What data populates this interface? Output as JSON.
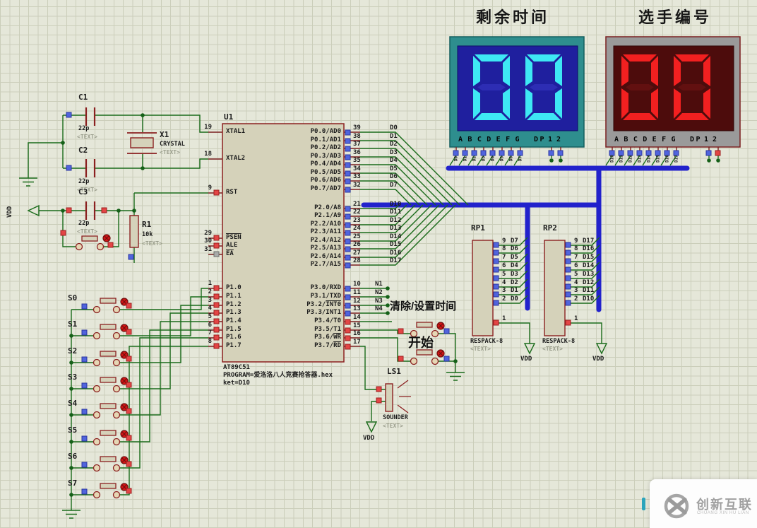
{
  "colors": {
    "bus": "#2222cc",
    "wire": "#1a6b1a",
    "outline": "#8b2020",
    "component_fill": "#d5d2ba",
    "grid_bg": "#e5e7d9",
    "grid_line": "#cbceba",
    "time_frame": "#2e8e8e",
    "time_bg": "#1f1f9e",
    "time_lit": "#3ee8f4",
    "time_dim": "#2d2db4",
    "player_frame": "#9a9a9a",
    "player_bg": "#4d0c0c",
    "player_lit": "#f22020",
    "player_dim": "#621010",
    "state_low": "#5064dd",
    "state_high": "#e34545",
    "state_float": "#a8aaa8"
  },
  "titles": {
    "time": "剩余时间",
    "player": "选手编号"
  },
  "displays": {
    "legend": "ABCDEFG",
    "dp": "DP",
    "commons": "12",
    "time_value": "00",
    "player_value": "00"
  },
  "u1": {
    "ref": "U1",
    "part": "AT89C51",
    "program": "PROGRAM=爱洛洛八人竞赛抢答器.hex",
    "note": "ket=D10",
    "left": [
      {
        "num": "19",
        "name": "XTAL1"
      },
      {
        "num": "18",
        "name": "XTAL2"
      },
      {
        "num": "9",
        "name": "RST"
      },
      {
        "num": "29",
        "ovname": "PSEN"
      },
      {
        "num": "30",
        "name": "ALE"
      },
      {
        "num": "31",
        "ovname": "EA"
      },
      {
        "num": "1",
        "name": "P1.0"
      },
      {
        "num": "2",
        "name": "P1.1"
      },
      {
        "num": "3",
        "name": "P1.2"
      },
      {
        "num": "4",
        "name": "P1.3"
      },
      {
        "num": "5",
        "name": "P1.4"
      },
      {
        "num": "6",
        "name": "P1.5"
      },
      {
        "num": "7",
        "name": "P1.6"
      },
      {
        "num": "8",
        "name": "P1.7"
      }
    ],
    "right": [
      {
        "num": "39",
        "name": "P0.0/AD0"
      },
      {
        "num": "38",
        "name": "P0.1/AD1"
      },
      {
        "num": "37",
        "name": "P0.2/AD2"
      },
      {
        "num": "36",
        "name": "P0.3/AD3"
      },
      {
        "num": "35",
        "name": "P0.4/AD4"
      },
      {
        "num": "34",
        "name": "P0.5/AD5"
      },
      {
        "num": "33",
        "name": "P0.6/AD6"
      },
      {
        "num": "32",
        "name": "P0.7/AD7"
      },
      {
        "num": "21",
        "name": "P2.0/A8"
      },
      {
        "num": "22",
        "name": "P2.1/A9"
      },
      {
        "num": "23",
        "name": "P2.2/A10"
      },
      {
        "num": "24",
        "name": "P2.3/A11"
      },
      {
        "num": "25",
        "name": "P2.4/A12"
      },
      {
        "num": "26",
        "name": "P2.5/A13"
      },
      {
        "num": "27",
        "name": "P2.6/A14"
      },
      {
        "num": "28",
        "name": "P2.7/A15"
      },
      {
        "num": "10",
        "name": "P3.0/RXD"
      },
      {
        "num": "11",
        "name": "P3.1/TXD"
      },
      {
        "num": "12",
        "name": "P3.2/",
        "ovname": "INT0"
      },
      {
        "num": "13",
        "name": "P3.3/INT1"
      },
      {
        "num": "14",
        "name": "P3.4/T0"
      },
      {
        "num": "15",
        "name": "P3.5/T1"
      },
      {
        "num": "16",
        "name": "P3.6/",
        "ovname": "WR"
      },
      {
        "num": "17",
        "name": "P3.7/",
        "ovname": "RD"
      }
    ]
  },
  "nets": {
    "p0": [
      "D0",
      "D1",
      "D2",
      "D3",
      "D4",
      "D5",
      "D6",
      "D7"
    ],
    "p2": [
      "D10",
      "D11",
      "D12",
      "D13",
      "D14",
      "D15",
      "D16",
      "D17"
    ],
    "n": [
      "N1",
      "N2",
      "N3",
      "N4"
    ]
  },
  "rp1": {
    "ref": "RP1",
    "part": "RESPACK-8",
    "ph": "<TEXT>",
    "pin1": "1",
    "pins": [
      "9",
      "8",
      "7",
      "6",
      "5",
      "4",
      "3",
      "2"
    ],
    "nets": [
      "D7",
      "D6",
      "D5",
      "D4",
      "D3",
      "D2",
      "D1",
      "D0"
    ]
  },
  "rp2": {
    "ref": "RP2",
    "part": "RESPACK-8",
    "ph": "<TEXT>",
    "pin1": "1",
    "pins": [
      "9",
      "8",
      "7",
      "6",
      "5",
      "4",
      "3",
      "2"
    ],
    "nets": [
      "D17",
      "D16",
      "D15",
      "D14",
      "D13",
      "D12",
      "D11",
      "D10"
    ]
  },
  "parts": {
    "c1": {
      "ref": "C1",
      "val": "22p",
      "ph": "<TEXT>"
    },
    "c2": {
      "ref": "C2",
      "val": "22p",
      "ph": "<TEXT>"
    },
    "c3": {
      "ref": "C3",
      "val": "22p",
      "ph": "<TEXT>"
    },
    "x1": {
      "ref": "X1",
      "type": "CRYSTAL",
      "ph": "<TEXT>"
    },
    "r1": {
      "ref": "R1",
      "val": "10k",
      "ph": "<TEXT>"
    },
    "ls1": {
      "ref": "LS1",
      "type": "SOUNDER",
      "ph": "<TEXT>"
    }
  },
  "keys": [
    "S0",
    "S1",
    "S2",
    "S3",
    "S4",
    "S5",
    "S6",
    "S7"
  ],
  "labels": {
    "clear_set": "清除/设置时间",
    "start": "开始",
    "vdd": "VDD"
  },
  "watermark": {
    "brand": "创新互联",
    "sub": "CHUANG XIN HU LIAN"
  }
}
